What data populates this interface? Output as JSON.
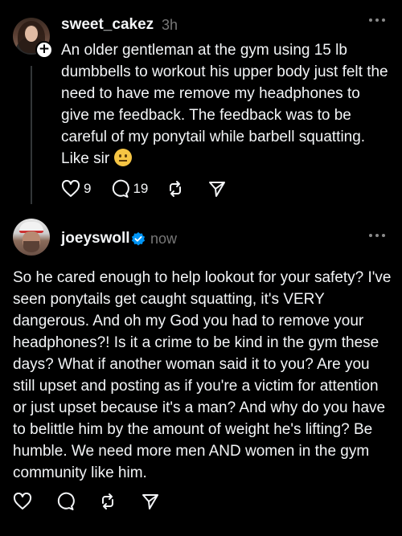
{
  "posts": [
    {
      "username": "sweet_cakez",
      "time": "3h",
      "text": "An older gentleman at the gym using 15 lb dumbbells to workout his upper body just felt the need to have me remove my headphones to give me feedback. The feedback was to be careful of my ponytail while barbell squatting. Like sir",
      "emoji": "neutral-face",
      "likes": "9",
      "replies": "19",
      "follow_badge": "+"
    },
    {
      "username": "joeyswoll",
      "verified": true,
      "time": "now",
      "text": "So he cared enough to help lookout for your safety? I've seen ponytails get caught squatting, it's VERY dangerous. And oh my God you had to remove your headphones?! Is it a crime to be kind in the gym these days? What if another woman said it to you? Are you still upset and posting as if you're a victim for attention or just upset because it's a man? And why do you have to belittle him by the amount of weight he's lifting? Be humble. We need more men AND women in the gym community like him."
    }
  ],
  "icons": {
    "like": "heart-icon",
    "reply": "comment-bubble-icon",
    "repost": "repost-icon",
    "share": "send-icon",
    "more": "more-dots-icon",
    "verified": "verified-badge-icon"
  },
  "colors": {
    "background": "#000000",
    "text": "#f3f5f7",
    "muted": "#777777",
    "verified": "#0095f6"
  }
}
